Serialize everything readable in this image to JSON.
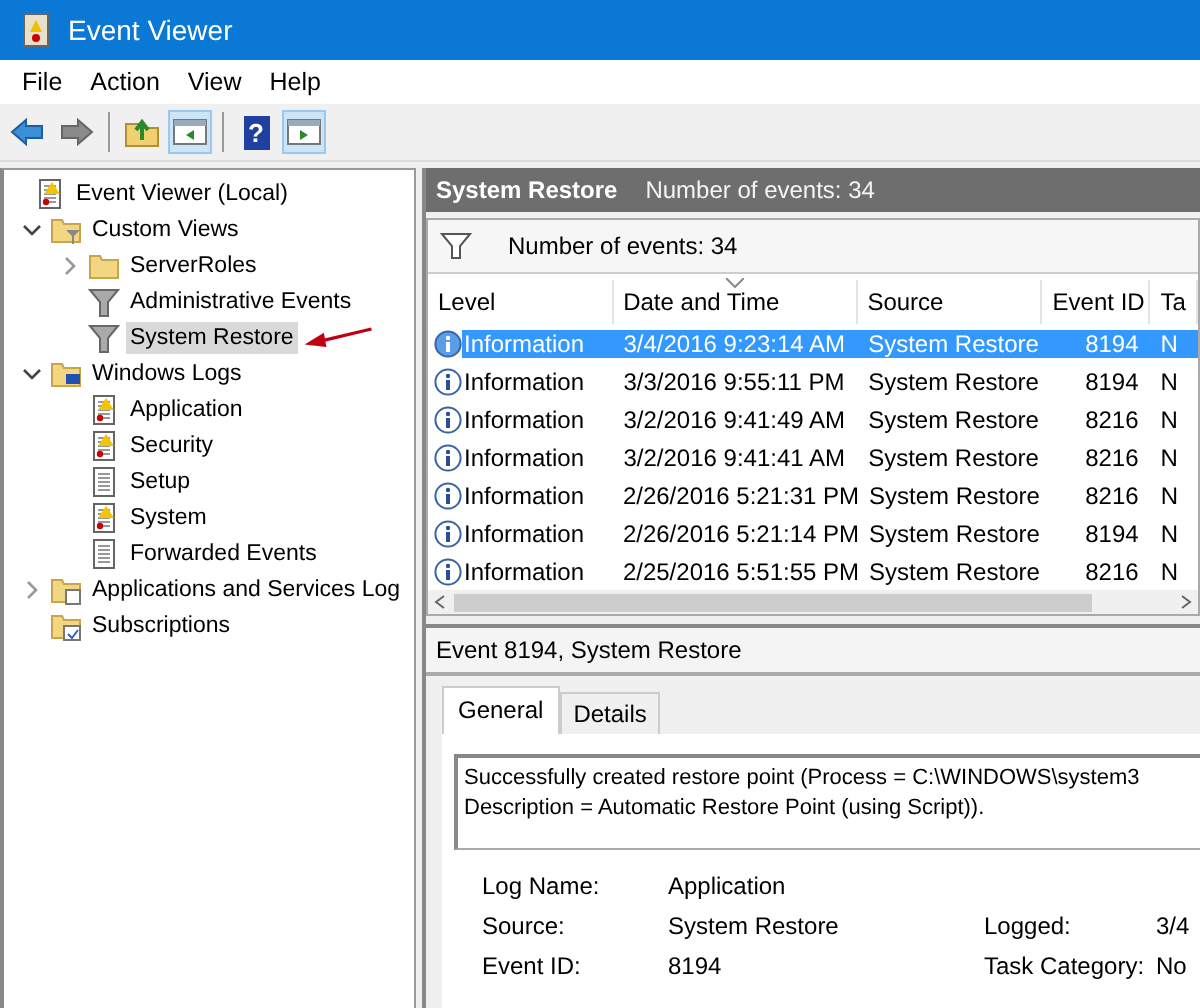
{
  "window": {
    "title": "Event Viewer"
  },
  "menu": [
    "File",
    "Action",
    "View",
    "Help"
  ],
  "toolbar": [
    {
      "kind": "back",
      "pressed": false
    },
    {
      "kind": "forward",
      "pressed": false
    },
    {
      "kind": "separator"
    },
    {
      "kind": "folder-up",
      "pressed": false
    },
    {
      "kind": "pane-left",
      "pressed": true
    },
    {
      "kind": "separator"
    },
    {
      "kind": "help",
      "glyph": "?",
      "pressed": false
    },
    {
      "kind": "pane-right",
      "pressed": true
    }
  ],
  "tree": [
    {
      "label": "Event Viewer (Local)",
      "kind": "log-book",
      "expandable": false,
      "selected": false,
      "callout": false,
      "children": [
        {
          "label": "Custom Views",
          "kind": "folder-filter",
          "expandable": true,
          "expanded": true,
          "selected": false,
          "callout": false,
          "children": [
            {
              "label": "ServerRoles",
              "kind": "folder",
              "expandable": true,
              "expanded": false,
              "selected": false,
              "callout": false
            },
            {
              "label": "Administrative Events",
              "kind": "filter",
              "expandable": false,
              "selected": false,
              "callout": false
            },
            {
              "label": "System Restore",
              "kind": "filter",
              "expandable": false,
              "selected": true,
              "callout": true
            }
          ]
        },
        {
          "label": "Windows Logs",
          "kind": "folder-computer",
          "expandable": true,
          "expanded": true,
          "selected": false,
          "callout": false,
          "children": [
            {
              "label": "Application",
              "kind": "log-warning",
              "expandable": false,
              "selected": false,
              "callout": false
            },
            {
              "label": "Security",
              "kind": "log-warning",
              "expandable": false,
              "selected": false,
              "callout": false
            },
            {
              "label": "Setup",
              "kind": "log",
              "expandable": false,
              "selected": false,
              "callout": false
            },
            {
              "label": "System",
              "kind": "log-warning",
              "expandable": false,
              "selected": false,
              "callout": false
            },
            {
              "label": "Forwarded Events",
              "kind": "log",
              "expandable": false,
              "selected": false,
              "callout": false
            }
          ]
        },
        {
          "label": "Applications and Services Log",
          "kind": "folder-log",
          "expandable": true,
          "expanded": false,
          "selected": false,
          "callout": false
        },
        {
          "label": "Subscriptions",
          "kind": "folder-calendar",
          "expandable": false,
          "selected": false,
          "callout": false
        }
      ]
    }
  ],
  "view_header": {
    "title": "System Restore",
    "count": "Number of events: 34"
  },
  "filter_bar": {
    "text": "Number of events: 34"
  },
  "table": {
    "columns": [
      {
        "label": "Level",
        "sorted": false
      },
      {
        "label": "Date and Time",
        "sorted": true
      },
      {
        "label": "Source",
        "sorted": false
      },
      {
        "label": "Event ID",
        "sorted": false
      },
      {
        "label": "Ta",
        "sorted": false
      }
    ],
    "rows": [
      {
        "selected": true,
        "cells": [
          "Information",
          "3/4/2016 9:23:14 AM",
          "System Restore",
          "8194",
          "N"
        ]
      },
      {
        "selected": false,
        "cells": [
          "Information",
          "3/3/2016 9:55:11 PM",
          "System Restore",
          "8194",
          "N"
        ]
      },
      {
        "selected": false,
        "cells": [
          "Information",
          "3/2/2016 9:41:49 AM",
          "System Restore",
          "8216",
          "N"
        ]
      },
      {
        "selected": false,
        "cells": [
          "Information",
          "3/2/2016 9:41:41 AM",
          "System Restore",
          "8216",
          "N"
        ]
      },
      {
        "selected": false,
        "cells": [
          "Information",
          "2/26/2016 5:21:31 PM",
          "System Restore",
          "8216",
          "N"
        ]
      },
      {
        "selected": false,
        "cells": [
          "Information",
          "2/26/2016 5:21:14 PM",
          "System Restore",
          "8194",
          "N"
        ]
      },
      {
        "selected": false,
        "cells": [
          "Information",
          "2/25/2016 5:51:55 PM",
          "System Restore",
          "8216",
          "N"
        ]
      }
    ]
  },
  "detail": {
    "title": "Event 8194, System Restore",
    "tabs": [
      {
        "label": "General",
        "selected": true
      },
      {
        "label": "Details",
        "selected": false
      }
    ],
    "message": [
      "Successfully created restore point (Process = C:\\WINDOWS\\system3",
      "Description = Automatic Restore Point (using Script))."
    ],
    "fields": [
      [
        {
          "label": "Log Name:",
          "value": "Application"
        }
      ],
      [
        {
          "label": "Source:",
          "value": "System Restore"
        },
        {
          "label": "Logged:",
          "value": "3/4"
        }
      ],
      [
        {
          "label": "Event ID:",
          "value": "8194"
        },
        {
          "label": "Task Category:",
          "value": "No"
        }
      ]
    ]
  }
}
